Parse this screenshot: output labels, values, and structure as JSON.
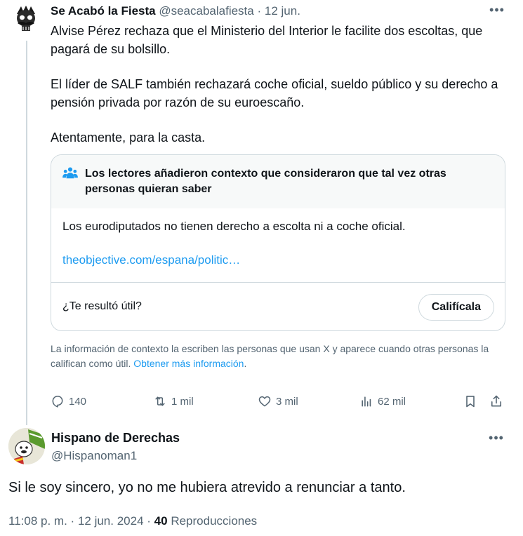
{
  "post": {
    "author_name": "Se Acabó la Fiesta",
    "author_handle": "@seacabalafiesta",
    "separator": "·",
    "date": "12 jun.",
    "more_icon": "more-horizontal-icon",
    "text_paragraphs": [
      "Alvise Pérez rechaza que el Ministerio del Interior le facilite dos escoltas, que pagará de su bolsillo.",
      "El líder de SALF también rechazará coche oficial, sueldo público y su derecho a pensión privada por razón de su euroescaño.",
      "Atentamente, para la casta."
    ],
    "community_note": {
      "icon": "people-icon",
      "heading": "Los lectores añadieron contexto que consideraron que tal vez otras personas quieran saber",
      "body": "Los eurodiputados no tienen derecho a escolta ni a coche oficial.",
      "link_text": "theobjective.com/espana/politic…",
      "question": "¿Te resultó útil?",
      "rate_button": "Califícala"
    },
    "disclaimer_text": "La información de contexto la escriben las personas que usan X y aparece cuando otras personas la califican como útil.",
    "disclaimer_link": "Obtener más información",
    "disclaimer_link_suffix": ".",
    "actions": {
      "reply": "140",
      "repost": "1 mil",
      "like": "3 mil",
      "views": "62 mil"
    },
    "colors": {
      "accent": "#1d9bf0",
      "secondary_text": "#536471",
      "border": "#cfd9de"
    }
  },
  "reply": {
    "author_name": "Hispano de Derechas",
    "author_handle": "@Hispanoman1",
    "text": "Si le soy sincero, yo no me hubiera atrevido a renunciar a tanto.",
    "time": "11:08 p. m.",
    "separator": "·",
    "date": "12 jun. 2024",
    "views_count": "40",
    "views_label": "Reproducciones"
  }
}
